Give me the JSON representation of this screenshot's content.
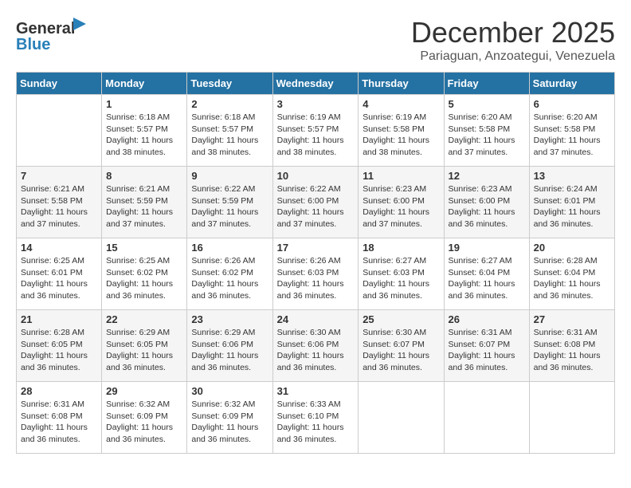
{
  "logo": {
    "general": "General",
    "blue": "Blue"
  },
  "title": "December 2025",
  "subtitle": "Pariaguan, Anzoategui, Venezuela",
  "days_of_week": [
    "Sunday",
    "Monday",
    "Tuesday",
    "Wednesday",
    "Thursday",
    "Friday",
    "Saturday"
  ],
  "weeks": [
    [
      {
        "day": "",
        "sunrise": "",
        "sunset": "",
        "daylight": ""
      },
      {
        "day": "1",
        "sunrise": "Sunrise: 6:18 AM",
        "sunset": "Sunset: 5:57 PM",
        "daylight": "Daylight: 11 hours and 38 minutes."
      },
      {
        "day": "2",
        "sunrise": "Sunrise: 6:18 AM",
        "sunset": "Sunset: 5:57 PM",
        "daylight": "Daylight: 11 hours and 38 minutes."
      },
      {
        "day": "3",
        "sunrise": "Sunrise: 6:19 AM",
        "sunset": "Sunset: 5:57 PM",
        "daylight": "Daylight: 11 hours and 38 minutes."
      },
      {
        "day": "4",
        "sunrise": "Sunrise: 6:19 AM",
        "sunset": "Sunset: 5:58 PM",
        "daylight": "Daylight: 11 hours and 38 minutes."
      },
      {
        "day": "5",
        "sunrise": "Sunrise: 6:20 AM",
        "sunset": "Sunset: 5:58 PM",
        "daylight": "Daylight: 11 hours and 37 minutes."
      },
      {
        "day": "6",
        "sunrise": "Sunrise: 6:20 AM",
        "sunset": "Sunset: 5:58 PM",
        "daylight": "Daylight: 11 hours and 37 minutes."
      }
    ],
    [
      {
        "day": "7",
        "sunrise": "Sunrise: 6:21 AM",
        "sunset": "Sunset: 5:58 PM",
        "daylight": "Daylight: 11 hours and 37 minutes."
      },
      {
        "day": "8",
        "sunrise": "Sunrise: 6:21 AM",
        "sunset": "Sunset: 5:59 PM",
        "daylight": "Daylight: 11 hours and 37 minutes."
      },
      {
        "day": "9",
        "sunrise": "Sunrise: 6:22 AM",
        "sunset": "Sunset: 5:59 PM",
        "daylight": "Daylight: 11 hours and 37 minutes."
      },
      {
        "day": "10",
        "sunrise": "Sunrise: 6:22 AM",
        "sunset": "Sunset: 6:00 PM",
        "daylight": "Daylight: 11 hours and 37 minutes."
      },
      {
        "day": "11",
        "sunrise": "Sunrise: 6:23 AM",
        "sunset": "Sunset: 6:00 PM",
        "daylight": "Daylight: 11 hours and 37 minutes."
      },
      {
        "day": "12",
        "sunrise": "Sunrise: 6:23 AM",
        "sunset": "Sunset: 6:00 PM",
        "daylight": "Daylight: 11 hours and 36 minutes."
      },
      {
        "day": "13",
        "sunrise": "Sunrise: 6:24 AM",
        "sunset": "Sunset: 6:01 PM",
        "daylight": "Daylight: 11 hours and 36 minutes."
      }
    ],
    [
      {
        "day": "14",
        "sunrise": "Sunrise: 6:25 AM",
        "sunset": "Sunset: 6:01 PM",
        "daylight": "Daylight: 11 hours and 36 minutes."
      },
      {
        "day": "15",
        "sunrise": "Sunrise: 6:25 AM",
        "sunset": "Sunset: 6:02 PM",
        "daylight": "Daylight: 11 hours and 36 minutes."
      },
      {
        "day": "16",
        "sunrise": "Sunrise: 6:26 AM",
        "sunset": "Sunset: 6:02 PM",
        "daylight": "Daylight: 11 hours and 36 minutes."
      },
      {
        "day": "17",
        "sunrise": "Sunrise: 6:26 AM",
        "sunset": "Sunset: 6:03 PM",
        "daylight": "Daylight: 11 hours and 36 minutes."
      },
      {
        "day": "18",
        "sunrise": "Sunrise: 6:27 AM",
        "sunset": "Sunset: 6:03 PM",
        "daylight": "Daylight: 11 hours and 36 minutes."
      },
      {
        "day": "19",
        "sunrise": "Sunrise: 6:27 AM",
        "sunset": "Sunset: 6:04 PM",
        "daylight": "Daylight: 11 hours and 36 minutes."
      },
      {
        "day": "20",
        "sunrise": "Sunrise: 6:28 AM",
        "sunset": "Sunset: 6:04 PM",
        "daylight": "Daylight: 11 hours and 36 minutes."
      }
    ],
    [
      {
        "day": "21",
        "sunrise": "Sunrise: 6:28 AM",
        "sunset": "Sunset: 6:05 PM",
        "daylight": "Daylight: 11 hours and 36 minutes."
      },
      {
        "day": "22",
        "sunrise": "Sunrise: 6:29 AM",
        "sunset": "Sunset: 6:05 PM",
        "daylight": "Daylight: 11 hours and 36 minutes."
      },
      {
        "day": "23",
        "sunrise": "Sunrise: 6:29 AM",
        "sunset": "Sunset: 6:06 PM",
        "daylight": "Daylight: 11 hours and 36 minutes."
      },
      {
        "day": "24",
        "sunrise": "Sunrise: 6:30 AM",
        "sunset": "Sunset: 6:06 PM",
        "daylight": "Daylight: 11 hours and 36 minutes."
      },
      {
        "day": "25",
        "sunrise": "Sunrise: 6:30 AM",
        "sunset": "Sunset: 6:07 PM",
        "daylight": "Daylight: 11 hours and 36 minutes."
      },
      {
        "day": "26",
        "sunrise": "Sunrise: 6:31 AM",
        "sunset": "Sunset: 6:07 PM",
        "daylight": "Daylight: 11 hours and 36 minutes."
      },
      {
        "day": "27",
        "sunrise": "Sunrise: 6:31 AM",
        "sunset": "Sunset: 6:08 PM",
        "daylight": "Daylight: 11 hours and 36 minutes."
      }
    ],
    [
      {
        "day": "28",
        "sunrise": "Sunrise: 6:31 AM",
        "sunset": "Sunset: 6:08 PM",
        "daylight": "Daylight: 11 hours and 36 minutes."
      },
      {
        "day": "29",
        "sunrise": "Sunrise: 6:32 AM",
        "sunset": "Sunset: 6:09 PM",
        "daylight": "Daylight: 11 hours and 36 minutes."
      },
      {
        "day": "30",
        "sunrise": "Sunrise: 6:32 AM",
        "sunset": "Sunset: 6:09 PM",
        "daylight": "Daylight: 11 hours and 36 minutes."
      },
      {
        "day": "31",
        "sunrise": "Sunrise: 6:33 AM",
        "sunset": "Sunset: 6:10 PM",
        "daylight": "Daylight: 11 hours and 36 minutes."
      },
      {
        "day": "",
        "sunrise": "",
        "sunset": "",
        "daylight": ""
      },
      {
        "day": "",
        "sunrise": "",
        "sunset": "",
        "daylight": ""
      },
      {
        "day": "",
        "sunrise": "",
        "sunset": "",
        "daylight": ""
      }
    ]
  ]
}
